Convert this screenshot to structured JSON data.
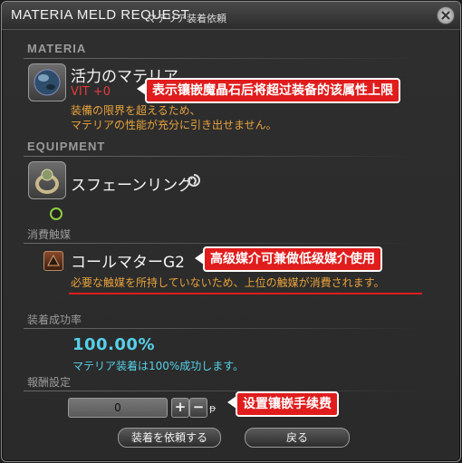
{
  "window": {
    "title_en": "MATERIA MELD REQUEST",
    "title_jp": "マテリア装着依頼"
  },
  "materia": {
    "section_label": "MATERIA",
    "name": "活力のマテリア",
    "stat": "VIT +0",
    "warning_line1": "装備の限界を超えるため、",
    "warning_line2": "マテリアの性能が充分に引き出せません。",
    "callout": "表示镶嵌魔晶石后将超过装备的该属性上限"
  },
  "equipment": {
    "section_label": "EQUIPMENT",
    "name": "スフェーンリング"
  },
  "catalyst": {
    "section_label": "消費触媒",
    "name": "コールマターG2",
    "note": "必要な触媒を所持していないため、上位の触媒が消費されます。",
    "callout": "高级媒介可兼做低级媒介使用"
  },
  "success": {
    "section_label": "装着成功率",
    "rate": "100.00%",
    "description": "マテリア装着は100%成功します。"
  },
  "reward": {
    "section_label": "報酬設定",
    "value": "0",
    "plus_label": "+",
    "minus_label": "−",
    "currency_symbol": "ᵽ",
    "callout": "设置镶嵌手续费"
  },
  "buttons": {
    "request": "装着を依頼する",
    "back": "戻る"
  },
  "colors": {
    "callout_red": "#e01c1c",
    "stat_red": "#e43b3b",
    "warning_orange": "#e8a33b",
    "success_blue": "#57d0e8"
  }
}
